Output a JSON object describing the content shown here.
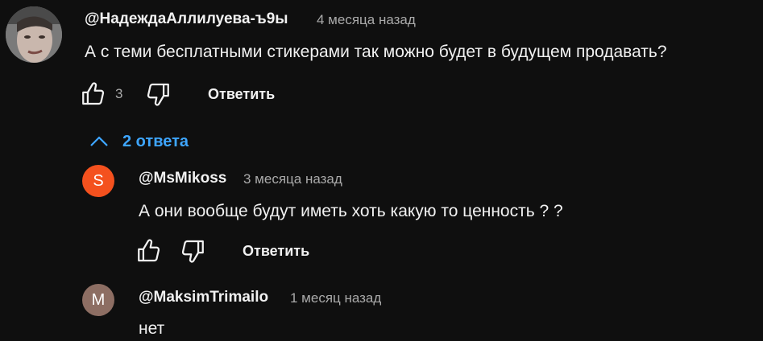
{
  "comment": {
    "author": "@НадеждаАллилуева-ъ9ы",
    "time": "4 месяца назад",
    "text": "А с теми бесплатными стикерами так можно будет в будущем продавать?",
    "likes": "3",
    "reply_label": "Ответить"
  },
  "replies_toggle": {
    "label": "2 ответа",
    "icon": "chevron-up-icon",
    "color": "#3ea6ff"
  },
  "replies": [
    {
      "avatar_letter": "S",
      "avatar_color": "#f4511e",
      "author": "@MsMikoss",
      "time": "3 месяца назад",
      "text": "А они вообще будут иметь хоть какую то ценность ? ?",
      "reply_label": "Ответить"
    },
    {
      "avatar_letter": "M",
      "avatar_color": "#8d6e63",
      "author": "@MaksimTrimailo",
      "time": "1 месяц назад",
      "text": "нет"
    }
  ]
}
